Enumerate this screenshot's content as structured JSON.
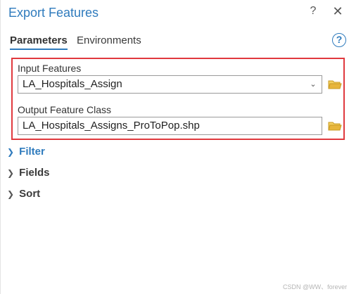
{
  "window": {
    "title": "Export Features",
    "help_glyph": "?",
    "close_glyph": "✕"
  },
  "tabs": [
    {
      "label": "Parameters",
      "active": true
    },
    {
      "label": "Environments",
      "active": false
    }
  ],
  "help_button": "?",
  "parameters": {
    "input_features": {
      "label": "Input Features",
      "value": "LA_Hospitals_Assign"
    },
    "output_feature_class": {
      "label": "Output Feature Class",
      "value": "LA_Hospitals_Assigns_ProToPop.shp"
    }
  },
  "sections": [
    {
      "label": "Filter",
      "expanded": false
    },
    {
      "label": "Fields",
      "expanded": false
    },
    {
      "label": "Sort",
      "expanded": false
    }
  ],
  "watermark": "CSDN @WW、forever",
  "colors": {
    "accent": "#2f7bbd",
    "highlight": "#e0393e",
    "folder": "#e7b53b"
  }
}
